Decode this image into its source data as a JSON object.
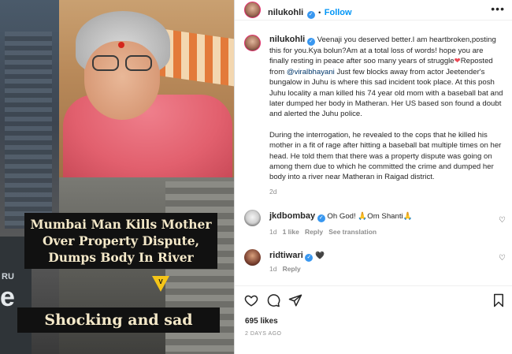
{
  "media": {
    "headline": "Mumbai Man Kills Mother Over Property Dispute, Dumps Body In River",
    "caption": "Shocking and sad",
    "sign_small": "RU",
    "sign_big": "e"
  },
  "header": {
    "username": "nilukohli",
    "separator": "•",
    "follow_label": "Follow",
    "more_label": "•••"
  },
  "post": {
    "author": "nilukohli",
    "text_1": "Veenaji you deserved better.I am heartbroken,posting this for you.Kya bolun?Am at a total loss of words! hope you are finally resting in peace after soo many years of struggle",
    "heart": "❤",
    "reposted_prefix": "Reposted from",
    "mention": "@viralbhayani",
    "text_2": "Just few blocks away from actor Jeetender's bungalow in Juhu is where this sad incident took place. At this posh Juhu locality a man killed his 74 year old mom with a baseball bat and later dumped her body in Matheran. Her US based son found a doubt and alerted the Juhu police.",
    "text_3": "During the interrogation, he revealed to the cops that he killed his mother in a fit of rage after hitting a baseball bat multiple times on her head. He told them that there was a property dispute was going on among them due to which he committed the crime and dumped her body into a river near Matheran in Raigad district.",
    "time": "2d"
  },
  "comments": [
    {
      "username": "jkdbombay",
      "text": "Oh God! 🙏Om Shanti🙏",
      "time": "1d",
      "likes": "1 like",
      "reply": "Reply",
      "translation": "See translation"
    },
    {
      "username": "ridtiwari",
      "text": "🖤",
      "time": "1d",
      "reply": "Reply"
    }
  ],
  "footer": {
    "likes": "695 likes",
    "posted": "2 DAYS AGO"
  },
  "icons": {
    "like": "heart-outline-icon",
    "comment": "comment-icon",
    "share": "share-icon",
    "save": "bookmark-icon"
  },
  "colors": {
    "accent": "#0095f6",
    "verified": "#3897f0",
    "heart": "#ed4956"
  }
}
